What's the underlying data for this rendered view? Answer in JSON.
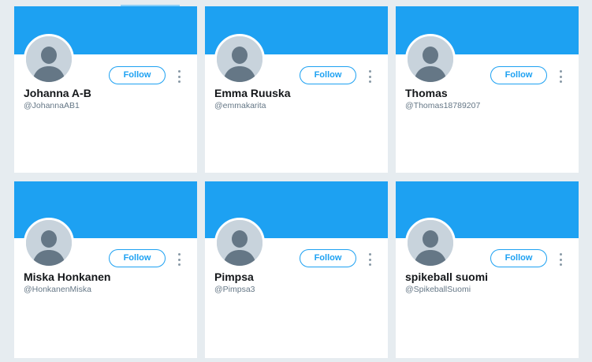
{
  "accent_color": "#1da1f2",
  "avatar_placeholder_icon": "default-user-silhouette-icon",
  "more_icon": "vertical-ellipsis-icon",
  "cards": [
    {
      "name": "Johanna A-B",
      "handle": "@JohannaAB1",
      "follow_label": "Follow"
    },
    {
      "name": "Emma Ruuska",
      "handle": "@emmakarita",
      "follow_label": "Follow"
    },
    {
      "name": "Thomas",
      "handle": "@Thomas18789207",
      "follow_label": "Follow"
    },
    {
      "name": "Miska Honkanen",
      "handle": "@HonkanenMiska",
      "follow_label": "Follow"
    },
    {
      "name": "Pimpsa",
      "handle": "@Pimpsa3",
      "follow_label": "Follow"
    },
    {
      "name": "spikeball suomi",
      "handle": "@SpikeballSuomi",
      "follow_label": "Follow"
    }
  ]
}
